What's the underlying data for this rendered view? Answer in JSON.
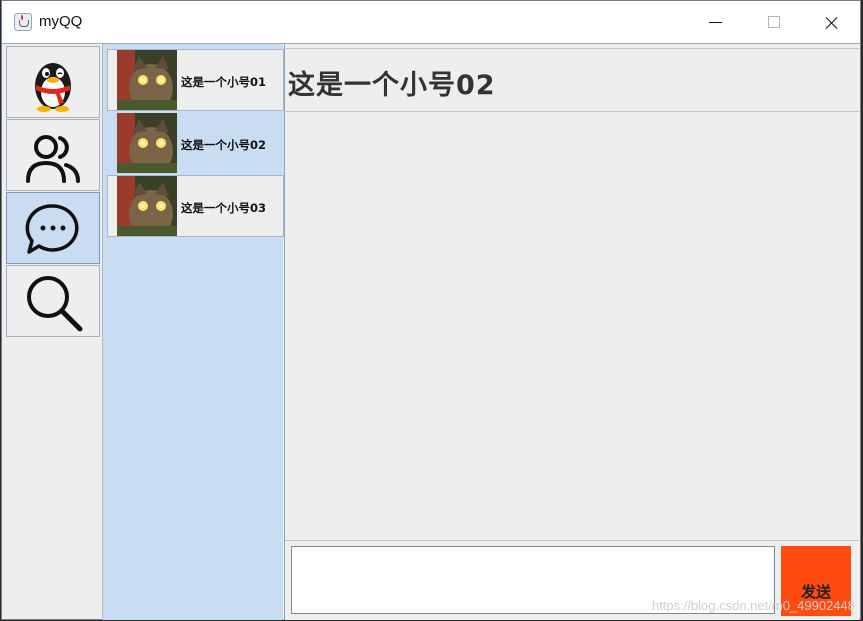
{
  "window": {
    "title": "myQQ",
    "icons": {
      "app": "java-cup-icon",
      "minimize": "minimize-icon",
      "maximize": "maximize-icon",
      "close": "close-icon"
    }
  },
  "nav": {
    "items": [
      {
        "name": "qq-penguin-icon",
        "active": false
      },
      {
        "name": "contacts-icon",
        "active": false
      },
      {
        "name": "chat-icon",
        "active": true
      },
      {
        "name": "search-icon",
        "active": false
      }
    ]
  },
  "conversations": {
    "items": [
      {
        "name": "这是一个小号01",
        "selected": false
      },
      {
        "name": "这是一个小号02",
        "selected": true
      },
      {
        "name": "这是一个小号03",
        "selected": false
      }
    ]
  },
  "chat": {
    "title": "这是一个小号02",
    "input_value": "",
    "send_label": "发送"
  },
  "watermark": "https://blog.csdn.net/m0_49902448",
  "colors": {
    "selection": "#c8dcf2",
    "send_button": "#ff4a10",
    "panel": "#eeeeee"
  }
}
